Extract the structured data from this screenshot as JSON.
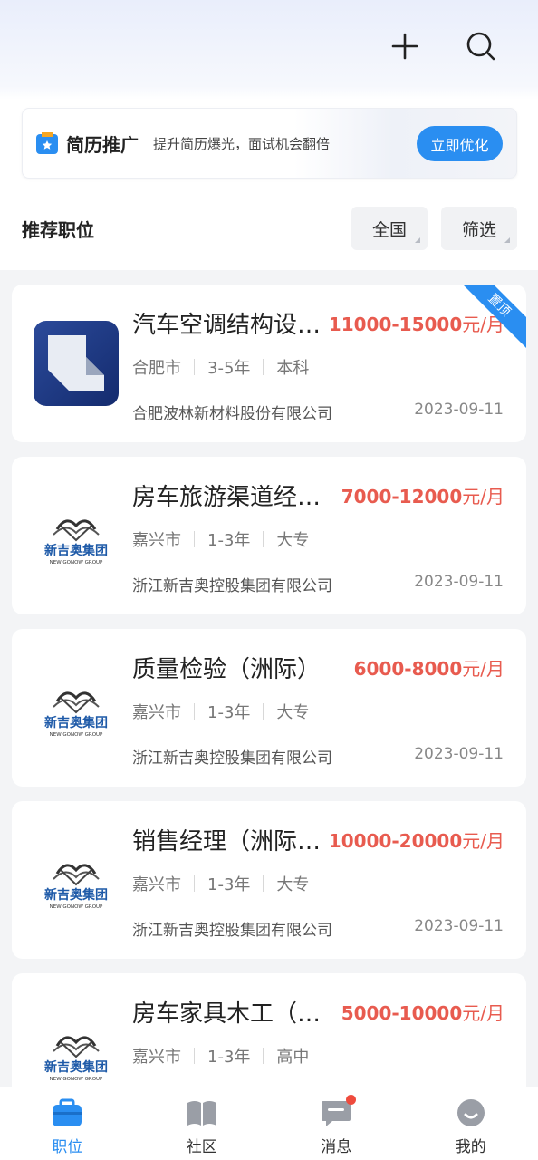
{
  "banner": {
    "title": "简历推广",
    "subtitle": "提升简历爆光，面试机会翻倍",
    "button": "立即优化"
  },
  "section": {
    "title": "推荐职位",
    "filters": [
      "全国",
      "筛选"
    ]
  },
  "jobs": [
    {
      "title": "汽车空调结构设…",
      "salary": "11000-15000",
      "unit": "元/月",
      "city": "合肥市",
      "experience": "3-5年",
      "education": "本科",
      "company": "合肥波林新材料股份有限公司",
      "date": "2023-09-11",
      "pinned": "置顶",
      "logo": "bolin-logo"
    },
    {
      "title": "房车旅游渠道经…",
      "salary": "7000-12000",
      "unit": "元/月",
      "city": "嘉兴市",
      "experience": "1-3年",
      "education": "大专",
      "company": "浙江新吉奥控股集团有限公司",
      "date": "2023-09-11",
      "logo": "new-gonow-logo",
      "logo_text": "新吉奥集团",
      "logo_sub": "NEW GONOW GROUP"
    },
    {
      "title": "质量检验（洲际）",
      "salary": "6000-8000",
      "unit": "元/月",
      "city": "嘉兴市",
      "experience": "1-3年",
      "education": "大专",
      "company": "浙江新吉奥控股集团有限公司",
      "date": "2023-09-11",
      "logo": "new-gonow-logo",
      "logo_text": "新吉奥集团",
      "logo_sub": "NEW GONOW GROUP"
    },
    {
      "title": "销售经理（洲际…",
      "salary": "10000-20000",
      "unit": "元/月",
      "city": "嘉兴市",
      "experience": "1-3年",
      "education": "大专",
      "company": "浙江新吉奥控股集团有限公司",
      "date": "2023-09-11",
      "logo": "new-gonow-logo",
      "logo_text": "新吉奥集团",
      "logo_sub": "NEW GONOW GROUP"
    },
    {
      "title": "房车家具木工（…",
      "salary": "5000-10000",
      "unit": "元/月",
      "city": "嘉兴市",
      "experience": "1-3年",
      "education": "高中",
      "company": "",
      "date": "",
      "logo": "new-gonow-logo",
      "logo_text": "新吉奥集团",
      "logo_sub": "NEW GONOW GROUP"
    }
  ],
  "tabbar": [
    {
      "label": "职位",
      "icon": "briefcase-icon",
      "active": true
    },
    {
      "label": "社区",
      "icon": "book-icon"
    },
    {
      "label": "消息",
      "icon": "message-icon",
      "badge": true
    },
    {
      "label": "我的",
      "icon": "profile-icon"
    }
  ],
  "colors": {
    "accent": "#2a8ef1",
    "salary": "#e85b4f",
    "badge": "#ef4b3d"
  }
}
